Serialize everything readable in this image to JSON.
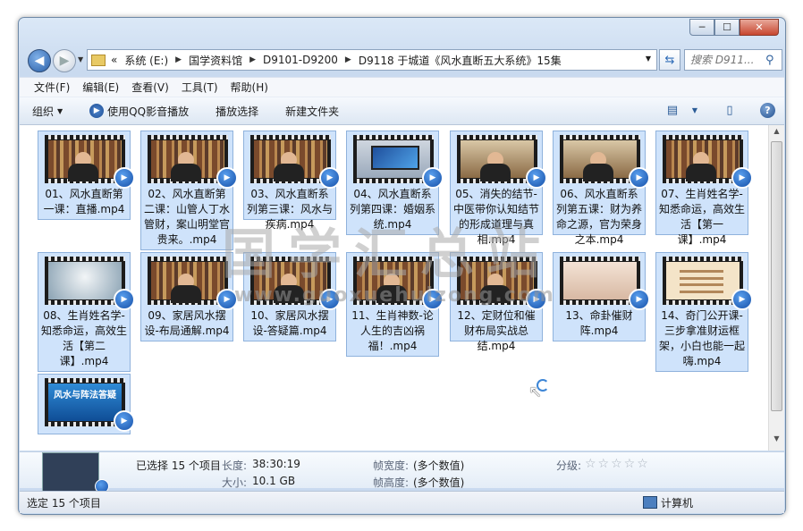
{
  "window": {
    "minimize": "─",
    "maximize": "☐",
    "close": "✕"
  },
  "address": {
    "overflow": "«",
    "crumbs": [
      "系统 (E:)",
      "国学资料馆",
      "D9101-D9200",
      "D9118 于城道《风水直断五大系统》15集"
    ]
  },
  "search": {
    "placeholder": "搜索 D911..."
  },
  "menu": [
    "文件(F)",
    "编辑(E)",
    "查看(V)",
    "工具(T)",
    "帮助(H)"
  ],
  "toolbar": {
    "organize": "组织",
    "play_qq": "使用QQ影音播放",
    "play_selection": "播放选择",
    "new_folder": "新建文件夹"
  },
  "files": [
    "01、风水直断第一课：直播.mp4",
    "02、风水直断第二课：山管人丁水管财，案山明堂官贵来。.mp4",
    "03、风水直断系列第三课：风水与疾病.mp4",
    "04、风水直断系列第四课：婚姻系统.mp4",
    "05、消失的结节-中医带你认知结节的形成道理与真相.mp4",
    "06、风水直断系列第五课：财为养命之源，官为荣身之本.mp4",
    "07、生肖姓名学-知悉命运，高效生活【第一课】.mp4",
    "08、生肖姓名学-知悉命运，高效生活【第二课】.mp4",
    "09、家居风水摆设-布局通解.mp4",
    "10、家居风水摆设-答疑篇.mp4",
    "11、生肖神数-论人生的吉凶祸福！.mp4",
    "12、定财位和催财布局实战总结.mp4",
    "13、命卦催财阵.mp4",
    "14、奇门公开课-三步拿准财运框架，小白也能一起嗨.mp4",
    "风水与阵法答疑"
  ],
  "watermark": {
    "cn": "国学汇总站",
    "url": "www.guoxuehuizong.com"
  },
  "details": {
    "selected": "已选择 15 个项目",
    "length_label": "长度:",
    "length": "38:30:19",
    "size_label": "大小:",
    "size": "10.1 GB",
    "width_label": "帧宽度:",
    "width": "(多个数值)",
    "height_label": "帧高度:",
    "height": "(多个数值)",
    "rating_label": "分级:",
    "rating_stars": "☆☆☆☆☆"
  },
  "status": {
    "left": "选定 15 个项目",
    "right": "计算机"
  }
}
